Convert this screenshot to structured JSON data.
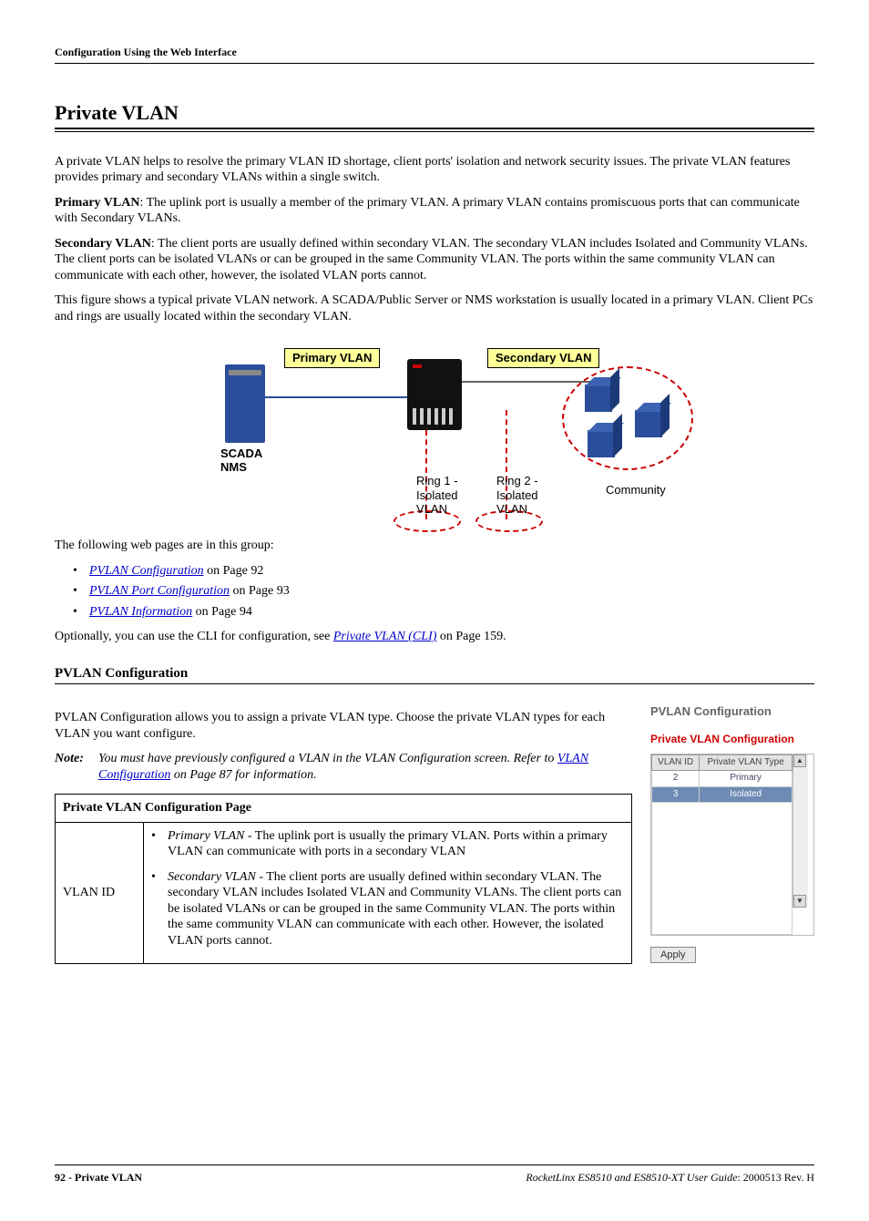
{
  "header": "Configuration Using the Web Interface",
  "title": "Private VLAN",
  "intro1": "A private VLAN helps to resolve the primary VLAN ID shortage, client ports' isolation and network security issues. The private VLAN features provides primary and secondary VLANs within a single switch.",
  "primary_label": "Primary VLAN",
  "primary_text": ": The uplink port is usually a member of the primary VLAN. A primary VLAN contains promiscuous ports that can communicate with Secondary VLANs.",
  "secondary_label": "Secondary VLAN",
  "secondary_text": ": The client ports are usually defined within secondary VLAN. The secondary VLAN includes Isolated and Community VLANs. The client ports can be isolated VLANs or can be grouped in the same Community VLAN. The ports within the same community VLAN can communicate with each other, however, the isolated VLAN ports cannot.",
  "figure_text": "This figure shows a typical private VLAN network. A SCADA/Public Server or NMS workstation is usually located in a primary VLAN. Client PCs and rings are usually located within the secondary VLAN.",
  "diagram": {
    "primary_vlan": "Primary VLAN",
    "secondary_vlan": "Secondary VLAN",
    "scada": "SCADA",
    "nms": "NMS",
    "ring1a": "Ring 1 -",
    "ring1b": "Isolated",
    "ring1c": "VLAN",
    "ring2a": "Ring 2 -",
    "ring2b": "Isolated",
    "ring2c": "VLAN",
    "community": "Community"
  },
  "group_intro": "The following web pages are in this group:",
  "links": [
    {
      "text": "PVLAN Configuration",
      "suffix": " on Page 92"
    },
    {
      "text": "PVLAN Port Configuration",
      "suffix": " on Page 93"
    },
    {
      "text": "PVLAN Information",
      "suffix": " on Page 94"
    }
  ],
  "cli_prefix": "Optionally, you can use the CLI for configuration, see ",
  "cli_link": "Private VLAN (CLI)",
  "cli_suffix": " on Page 159.",
  "section2_title": "PVLAN Configuration",
  "section2_intro": "PVLAN Configuration allows you to assign a private VLAN type. Choose the private VLAN types for each VLAN you want configure.",
  "note_label": "Note:",
  "note_prefix": "You must have previously configured a VLAN in the VLAN Configuration screen. Refer to ",
  "note_link": "VLAN Configuration",
  "note_suffix": " on Page 87 for information.",
  "table": {
    "header": "Private VLAN Configuration Page",
    "rowlabel": "VLAN ID",
    "b1_label": "Primary VLAN",
    "b1_text": " - The uplink port is usually the primary VLAN. Ports within a primary VLAN can communicate with ports in a secondary VLAN",
    "b2_label": "Secondary VLAN",
    "b2_text": " - The client ports are usually defined within secondary VLAN. The secondary VLAN includes Isolated VLAN and Community VLANs. The client ports can be isolated VLANs or can be grouped in the same Community VLAN. The ports within the same community VLAN can communicate with each other. However, the isolated VLAN ports cannot."
  },
  "side": {
    "title": "PVLAN Configuration",
    "subtitle": "Private VLAN Configuration",
    "col1": "VLAN ID",
    "col2": "Private VLAN Type",
    "rows": [
      {
        "id": "2",
        "type": "Primary"
      },
      {
        "id": "3",
        "type": "Isolated"
      }
    ],
    "apply": "Apply"
  },
  "footer": {
    "left_page": "92 - ",
    "left_title": "Private VLAN",
    "right_italic": "RocketLinx ES8510  and ES8510-XT User Guide",
    "right_rev": ": 2000513 Rev. H"
  }
}
